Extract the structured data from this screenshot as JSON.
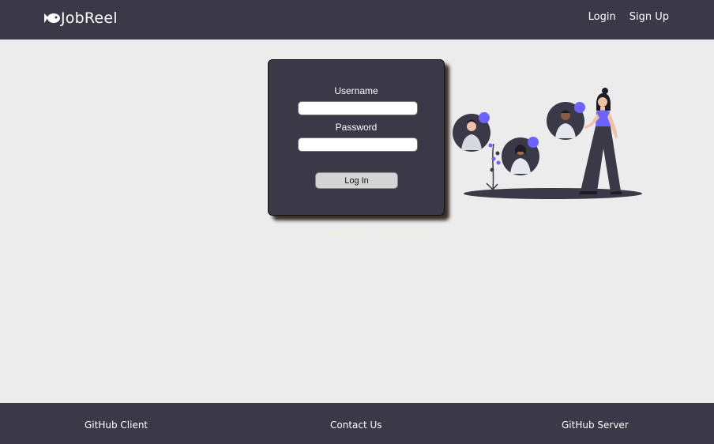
{
  "navbar": {
    "brand": "JobReel",
    "links": [
      "Login",
      "Sign Up"
    ]
  },
  "login_form": {
    "username_label": "Username",
    "username_value": "",
    "password_label": "Password",
    "password_value": "",
    "submit_label": "Log In",
    "secondary_link": "Need an account? Sign up here"
  },
  "footer": {
    "links": [
      "GitHub Client",
      "Contact Us",
      "GitHub Server"
    ]
  },
  "colors": {
    "bar": "#3b3847",
    "page_bg": "#ececec",
    "accent": "#6c63ff"
  }
}
